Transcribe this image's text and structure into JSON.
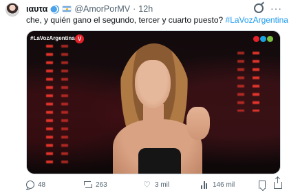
{
  "author": {
    "name": "ιαυτα",
    "handle": "@AmorPorMV",
    "separator": "·",
    "time": "12h"
  },
  "tweet": {
    "text": "che, y quién gano el segundo, tercer y cuarto puesto? ",
    "hashtag": "#LaVozArgentina"
  },
  "media": {
    "overlay_hashtag": "#LaVozArgentina",
    "logo_letter": "V",
    "channel_logo_icon": "telefe-logo-icon"
  },
  "actions": {
    "replies": "48",
    "retweets": "263",
    "likes": "3 mil",
    "views": "146 mil"
  }
}
